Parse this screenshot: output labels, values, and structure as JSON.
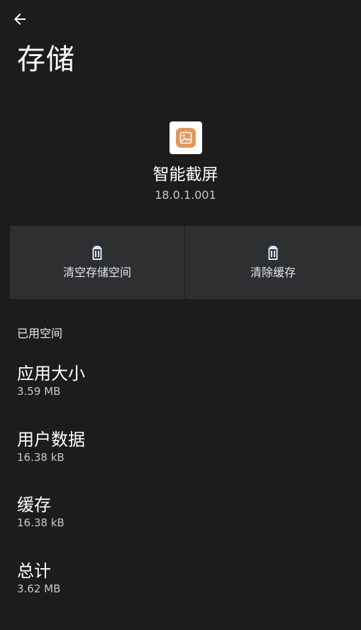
{
  "header": {
    "title": "存储"
  },
  "app": {
    "name": "智能截屏",
    "version": "18.0.1.001",
    "icon_color": "#e0985a"
  },
  "actions": {
    "clear_storage_label": "清空存储空间",
    "clear_cache_label": "清除缓存"
  },
  "usage": {
    "section_title": "已用空间",
    "items": [
      {
        "label": "应用大小",
        "value": "3.59 MB"
      },
      {
        "label": "用户数据",
        "value": "16.38 kB"
      },
      {
        "label": "缓存",
        "value": "16.38 kB"
      },
      {
        "label": "总计",
        "value": "3.62 MB"
      }
    ]
  },
  "colors": {
    "background": "#1c1c1d",
    "action_background": "#2e2f31",
    "action_accent": "#d9e2ff"
  },
  "icons": {
    "back": "arrow-back-icon",
    "delete": "trash-icon",
    "app": "image-icon"
  }
}
